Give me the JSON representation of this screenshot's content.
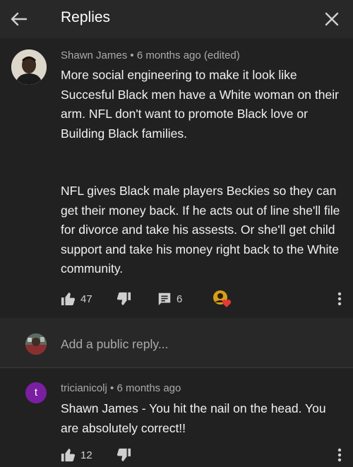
{
  "header": {
    "title": "Replies",
    "back_icon": "arrow-left-icon",
    "close_icon": "close-icon"
  },
  "main_comment": {
    "author": "Shawn James",
    "separator": "•",
    "time": "6 months ago (edited)",
    "paragraph1": "More social engineering to make it look like Succesful Black men have a White woman on their arm. NFL don't want to promote Black love or Building Black families.",
    "paragraph2": "NFL gives Black male players Beckies so they can get their money back. If he acts out of line she'll file for divorce and take his assests. Or she'll get child support and take his money right back to the White community.",
    "likes": "47",
    "replies_count": "6"
  },
  "reply_box": {
    "placeholder": "Add a public reply..."
  },
  "reply_comment": {
    "avatar_letter": "t",
    "author": "tricianicolj",
    "separator": "•",
    "time": "6 months ago",
    "text": "Shawn James - You hit the nail on the head. You are absolutely correct!!",
    "likes": "12"
  },
  "colors": {
    "background": "#212121",
    "header": "#282828",
    "secondary_text": "#aaaaaa",
    "avatar_t": "#7b1fa2"
  }
}
